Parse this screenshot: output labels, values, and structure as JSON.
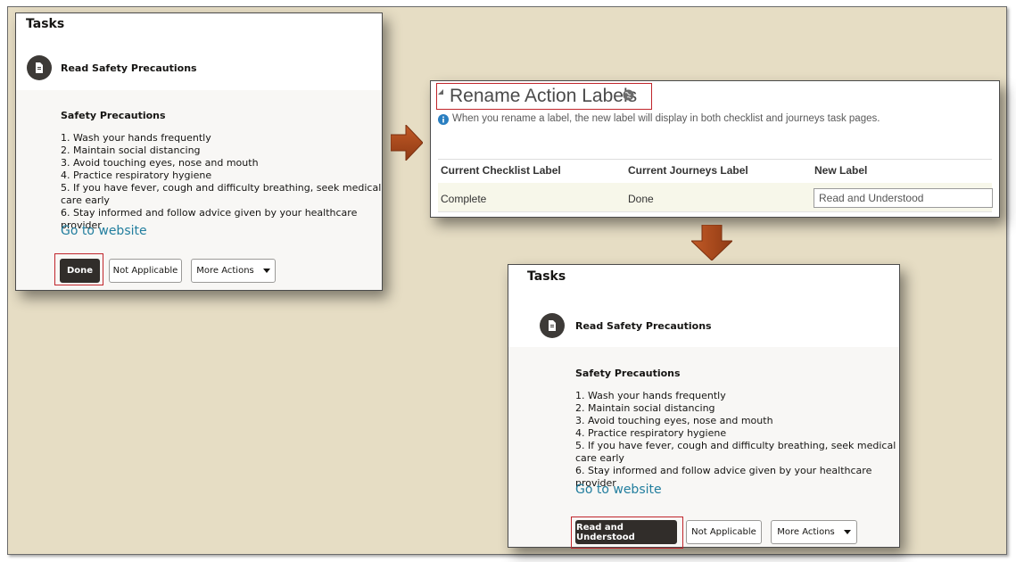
{
  "before": {
    "heading": "Tasks",
    "task_name": "Read Safety Precautions",
    "section_title": "Safety Precautions",
    "steps": [
      "1. Wash your hands frequently",
      "2. Maintain social distancing",
      "3. Avoid touching eyes, nose and mouth",
      "4. Practice respiratory hygiene",
      "5. If you have fever, cough and difficulty breathing, seek medical care early",
      "6. Stay informed and follow advice given by your healthcare provider"
    ],
    "link": "Go to website",
    "primary_button": "Done",
    "secondary_button": "Not Applicable",
    "more_button": "More Actions"
  },
  "rename": {
    "title": "Rename Action Labels",
    "info": "When you rename a label, the new label will display in both checklist and journeys task pages.",
    "columns": [
      "Current Checklist Label",
      "Current Journeys Label",
      "New Label"
    ],
    "row": {
      "checklist": "Complete",
      "journeys": "Done",
      "new_label": "Read and Understood"
    }
  },
  "after": {
    "heading": "Tasks",
    "task_name": "Read Safety Precautions",
    "section_title": "Safety Precautions",
    "steps": [
      "1. Wash your hands frequently",
      "2. Maintain social distancing",
      "3. Avoid touching eyes, nose and mouth",
      "4. Practice respiratory hygiene",
      "5. If you have fever, cough and difficulty breathing, seek medical care early",
      "6. Stay informed and follow advice given by your healthcare provider"
    ],
    "link": "Go to website",
    "primary_button": "Read and Understood",
    "secondary_button": "Not Applicable",
    "more_button": "More Actions"
  },
  "colors": {
    "background": "#e6ddc4",
    "highlight": "#c0252b",
    "arrow": "#a8481c",
    "link": "#227e9e",
    "primary_button": "#312d2a"
  }
}
